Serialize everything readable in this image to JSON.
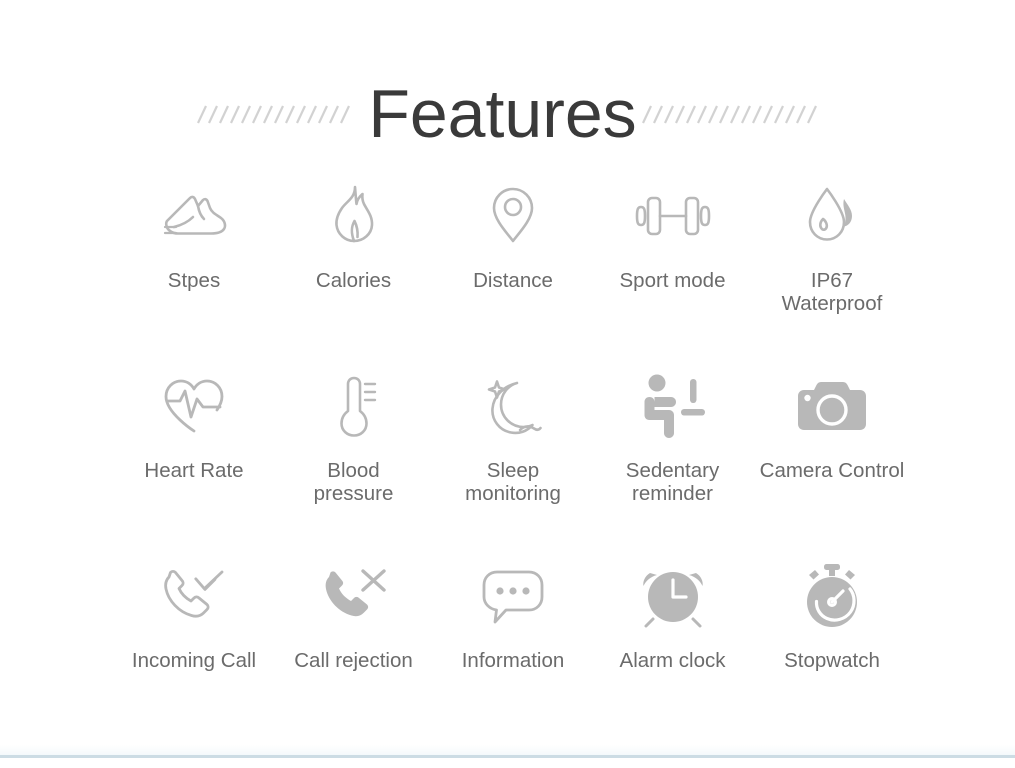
{
  "page": {
    "title": "Features",
    "background_color": "#ffffff",
    "title_color": "#3a3a3a",
    "label_color": "#6b6b6b",
    "icon_color": "#b4b4b4",
    "rule_color": "#ccdce4"
  },
  "decorations": {
    "hatch_left": "diagonal-hatch-marks",
    "hatch_right": "diagonal-hatch-marks"
  },
  "features": {
    "rows": [
      [
        {
          "label": "Stpes",
          "icon": "running-shoe-icon"
        },
        {
          "label": "Calories",
          "icon": "flame-icon"
        },
        {
          "label": "Distance",
          "icon": "location-pin-icon"
        },
        {
          "label": "Sport mode",
          "icon": "dumbbell-icon"
        },
        {
          "label": "IP67\nWaterproof",
          "icon": "water-drop-icon"
        }
      ],
      [
        {
          "label": "Heart Rate",
          "icon": "heart-pulse-icon"
        },
        {
          "label": "Blood\npressure",
          "icon": "thermometer-icon"
        },
        {
          "label": "Sleep\nmonitoring",
          "icon": "crescent-moon-icon"
        },
        {
          "label": "Sedentary\nreminder",
          "icon": "seated-person-alert-icon"
        },
        {
          "label": "Camera Control",
          "icon": "camera-icon"
        }
      ],
      [
        {
          "label": "Incoming Call",
          "icon": "incoming-call-icon"
        },
        {
          "label": "Call rejection",
          "icon": "call-reject-icon"
        },
        {
          "label": "Information",
          "icon": "speech-bubble-icon"
        },
        {
          "label": "Alarm clock",
          "icon": "alarm-clock-icon"
        },
        {
          "label": "Stopwatch",
          "icon": "stopwatch-icon"
        }
      ]
    ]
  }
}
